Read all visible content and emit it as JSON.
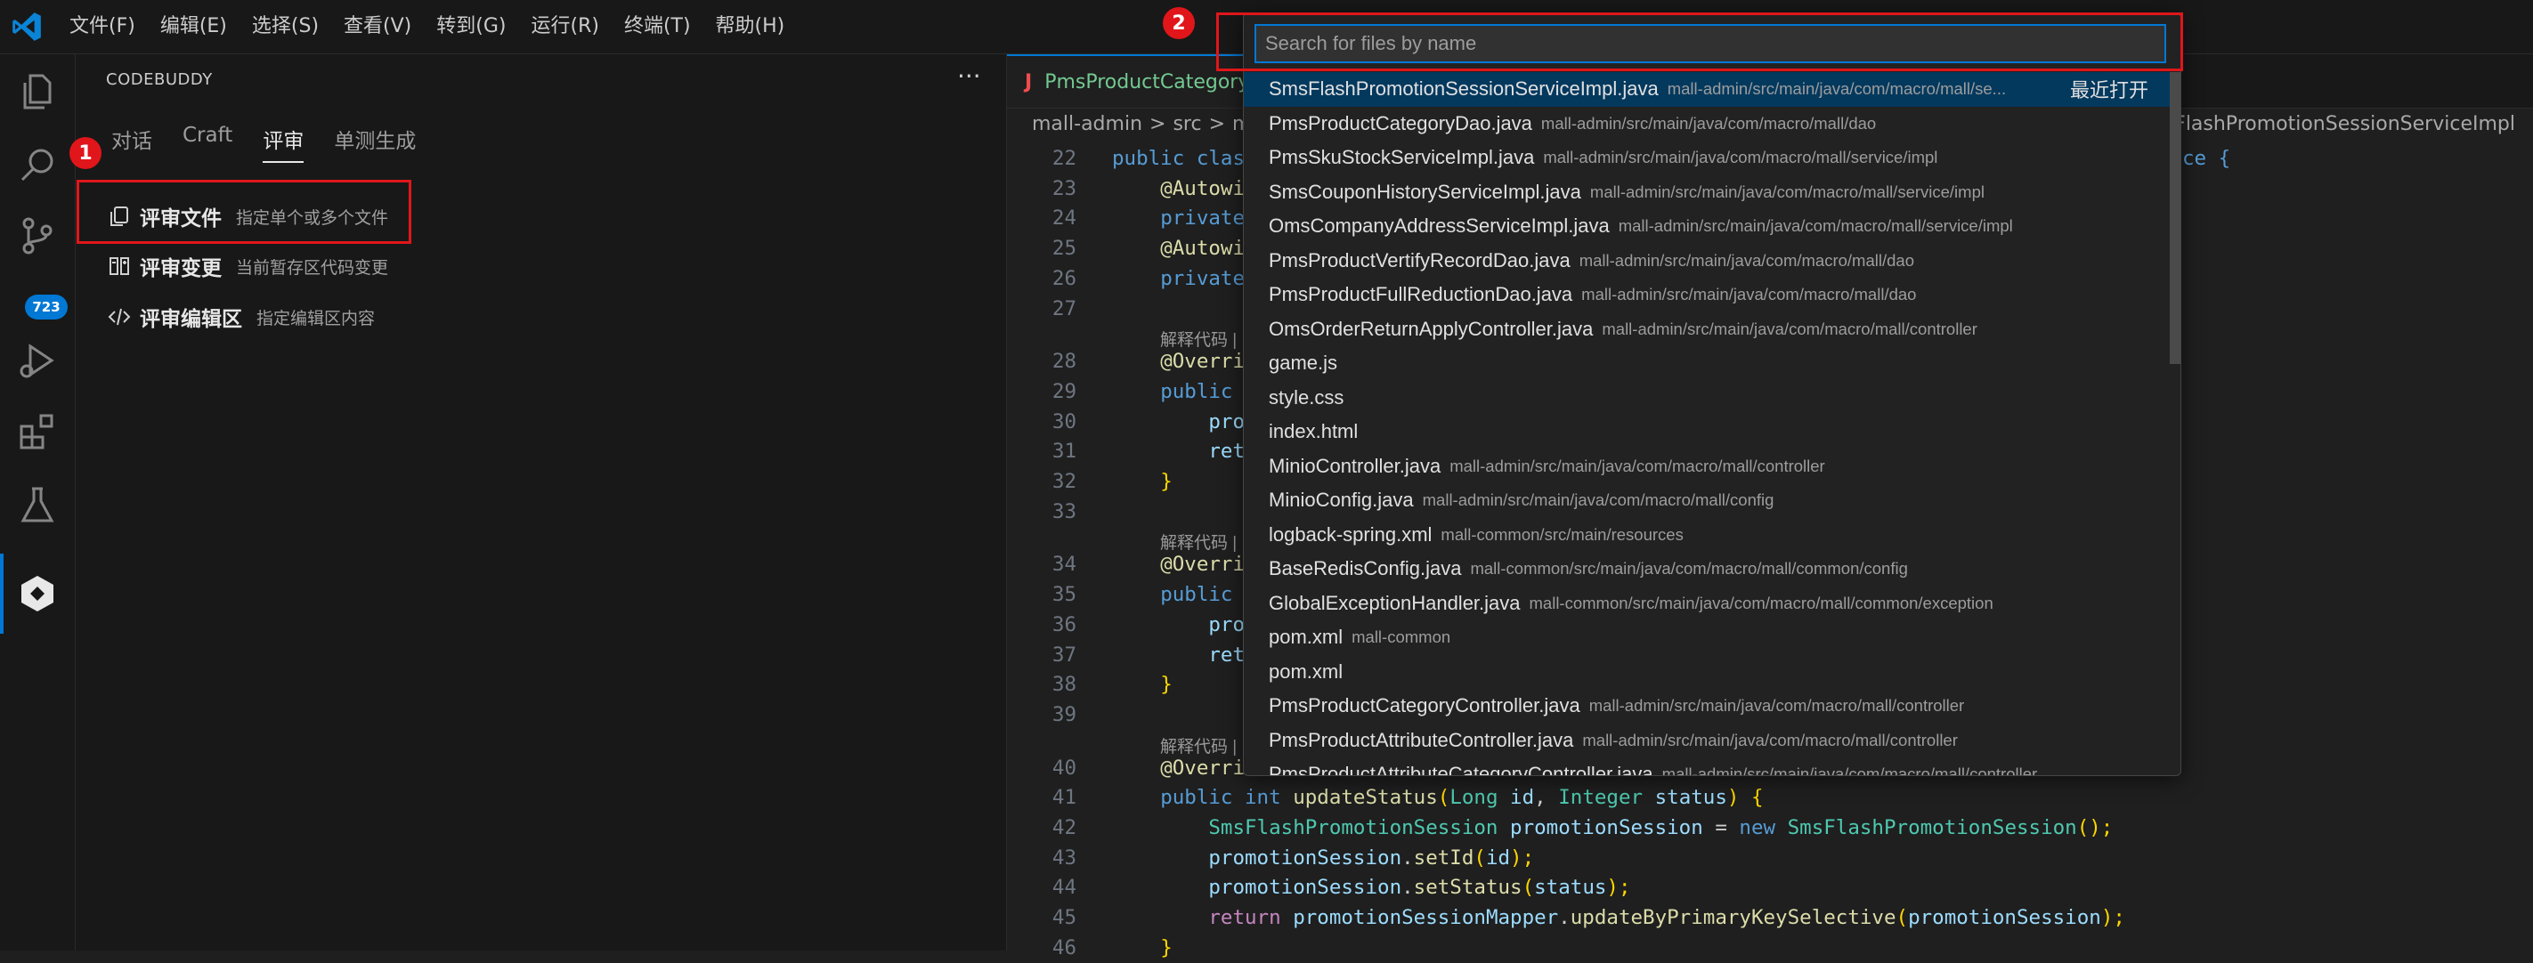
{
  "menu": [
    "文件(F)",
    "编辑(E)",
    "选择(S)",
    "查看(V)",
    "转到(G)",
    "运行(R)",
    "终端(T)",
    "帮助(H)"
  ],
  "activity": {
    "scm_badge": "723"
  },
  "sidebar": {
    "title": "CODEBUDDY",
    "more": "···",
    "tabs": [
      "对话",
      "Craft",
      "评审",
      "单测生成"
    ],
    "active_tab": "评审",
    "items": [
      {
        "title": "评审文件",
        "desc": "指定单个或多个文件"
      },
      {
        "title": "评审变更",
        "desc": "当前暂存区代码变更"
      },
      {
        "title": "评审编辑区",
        "desc": "指定编辑区内容"
      }
    ]
  },
  "annotations": {
    "step1": "1",
    "step2": "2"
  },
  "editor": {
    "tab_label": "PmsProductCategory",
    "tab_icon": "J",
    "breadcrumb": [
      "mall-admin",
      ">",
      "src",
      ">",
      "main"
    ],
    "breadcrumb_right": "msFlashPromotionSessionServiceImpl",
    "lens_text": "解释代码 |",
    "lines": [
      {
        "n": "22",
        "t": "public class"
      },
      {
        "n": "23",
        "t": "    @Autowi"
      },
      {
        "n": "24",
        "t": "    private"
      },
      {
        "n": "25",
        "t": "    @Autowi"
      },
      {
        "n": "26",
        "t": "    private"
      },
      {
        "n": "27",
        "t": ""
      },
      {
        "n": "28",
        "t": "    @Overri"
      },
      {
        "n": "29",
        "t": "    public"
      },
      {
        "n": "30",
        "t": "        pro"
      },
      {
        "n": "31",
        "t": "        ret"
      },
      {
        "n": "32",
        "t": "    }"
      },
      {
        "n": "33",
        "t": ""
      },
      {
        "n": "34",
        "t": "    @Overri"
      },
      {
        "n": "35",
        "t": "    public"
      },
      {
        "n": "36",
        "t": "        pro"
      },
      {
        "n": "37",
        "t": "        ret"
      },
      {
        "n": "38",
        "t": "    }"
      },
      {
        "n": "39",
        "t": ""
      },
      {
        "n": "40",
        "t": "    @Overri"
      },
      {
        "n": "41",
        "t": "    public int updateStatus(Long id, Integer status) {"
      },
      {
        "n": "42",
        "t": "        SmsFlashPromotionSession promotionSession = new SmsFlashPromotionSession();"
      },
      {
        "n": "43",
        "t": "        promotionSession.setId(id);"
      },
      {
        "n": "44",
        "t": "        promotionSession.setStatus(status);"
      },
      {
        "n": "45",
        "t": "        return promotionSessionMapper.updateByPrimaryKeySelective(promotionSession);"
      },
      {
        "n": "46",
        "t": "    }"
      }
    ],
    "line22_tail": "ce {"
  },
  "quickopen": {
    "placeholder": "Search for files by name",
    "recent_tag": "最近打开",
    "items": [
      {
        "name": "SmsFlashPromotionSessionServiceImpl.java",
        "path": "mall-admin/src/main/java/com/macro/mall/se..."
      },
      {
        "name": "PmsProductCategoryDao.java",
        "path": "mall-admin/src/main/java/com/macro/mall/dao"
      },
      {
        "name": "PmsSkuStockServiceImpl.java",
        "path": "mall-admin/src/main/java/com/macro/mall/service/impl"
      },
      {
        "name": "SmsCouponHistoryServiceImpl.java",
        "path": "mall-admin/src/main/java/com/macro/mall/service/impl"
      },
      {
        "name": "OmsCompanyAddressServiceImpl.java",
        "path": "mall-admin/src/main/java/com/macro/mall/service/impl"
      },
      {
        "name": "PmsProductVertifyRecordDao.java",
        "path": "mall-admin/src/main/java/com/macro/mall/dao"
      },
      {
        "name": "PmsProductFullReductionDao.java",
        "path": "mall-admin/src/main/java/com/macro/mall/dao"
      },
      {
        "name": "OmsOrderReturnApplyController.java",
        "path": "mall-admin/src/main/java/com/macro/mall/controller"
      },
      {
        "name": "game.js",
        "path": ""
      },
      {
        "name": "style.css",
        "path": ""
      },
      {
        "name": "index.html",
        "path": ""
      },
      {
        "name": "MinioController.java",
        "path": "mall-admin/src/main/java/com/macro/mall/controller"
      },
      {
        "name": "MinioConfig.java",
        "path": "mall-admin/src/main/java/com/macro/mall/config"
      },
      {
        "name": "logback-spring.xml",
        "path": "mall-common/src/main/resources"
      },
      {
        "name": "BaseRedisConfig.java",
        "path": "mall-common/src/main/java/com/macro/mall/common/config"
      },
      {
        "name": "GlobalExceptionHandler.java",
        "path": "mall-common/src/main/java/com/macro/mall/common/exception"
      },
      {
        "name": "pom.xml",
        "path": "mall-common"
      },
      {
        "name": "pom.xml",
        "path": ""
      },
      {
        "name": "PmsProductCategoryController.java",
        "path": "mall-admin/src/main/java/com/macro/mall/controller"
      },
      {
        "name": "PmsProductAttributeController.java",
        "path": "mall-admin/src/main/java/com/macro/mall/controller"
      },
      {
        "name": "PmsProductAttributeCategoryController.java",
        "path": "mall-admin/src/main/java/com/macro/mall/controller"
      }
    ]
  },
  "colors": {
    "accent": "#0078d4",
    "annotation_red": "#e0161a",
    "selection": "#04395e"
  }
}
